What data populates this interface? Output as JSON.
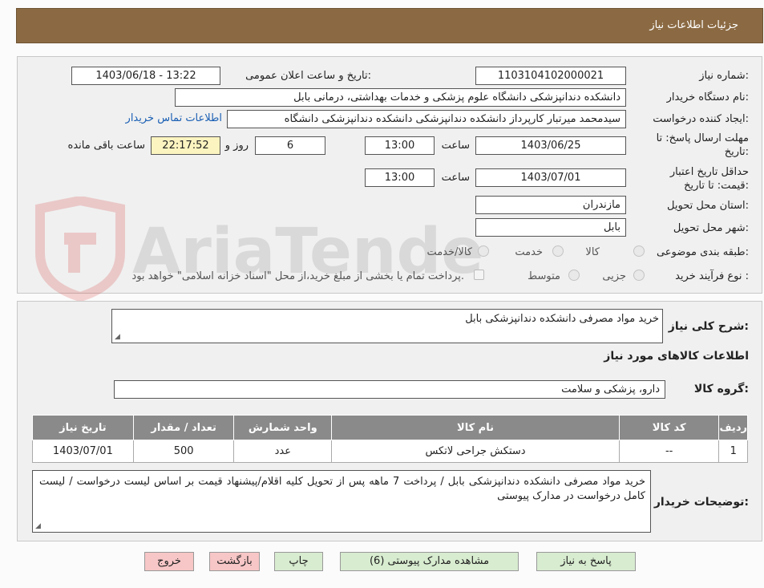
{
  "header": {
    "title": "جزئیات اطلاعات نیاز"
  },
  "watermark": {
    "text": "AriaTender.neT"
  },
  "info": {
    "need_number_label": "شماره نیاز:",
    "need_number": "1103104102000021",
    "announce_label": "تاریخ و ساعت اعلان عمومی:",
    "announce_value": "1403/06/18 - 13:22",
    "buyer_label": "نام دستگاه خریدار:",
    "buyer_value": "دانشکده دندانپزشکی دانشگاه علوم پزشکی و خدمات بهداشتی، درمانی بابل",
    "requester_label": "ایجاد کننده درخواست:",
    "requester_value": "سیدمحمد میرتبار کارپرداز دانشکده دندانپزشکی دانشکده دندانپزشکی دانشگاه",
    "contact_link": "اطلاعات تماس خریدار",
    "deadline_label_1": "مهلت ارسال پاسخ: تا",
    "deadline_label_2": "تاریخ:",
    "deadline_date": "1403/06/25",
    "time_label": "ساعت",
    "deadline_time": "13:00",
    "days_value": "6",
    "days_label": "روز و",
    "remaining_time": "22:17:52",
    "remaining_label": "ساعت باقی مانده",
    "validity_label_1": "حداقل تاریخ اعتبار",
    "validity_label_2": "قیمت: تا تاریخ:",
    "validity_date": "1403/07/01",
    "validity_time": "13:00",
    "province_label": "استان محل تحویل:",
    "province_value": "مازندران",
    "city_label": "شهر محل تحویل:",
    "city_value": "بابل",
    "category_label": "طبقه بندی موضوعی:",
    "cat_goods": "کالا",
    "cat_service": "خدمت",
    "cat_goods_service": "کالا/خدمت",
    "process_label": "نوع فرآیند خرید :",
    "proc_minor": "جزیی",
    "proc_medium": "متوسط",
    "payment_note": "پرداخت تمام یا بخشی از مبلغ خرید،از محل \"اسناد خزانه اسلامی\" خواهد بود."
  },
  "details": {
    "summary_label": "شرح کلی نیاز:",
    "summary_value": "خرید مواد مصرفی دانشکده دندانپزشکی بابل",
    "goods_info_title": "اطلاعات کالاهای مورد نیاز",
    "goods_group_label": "گروه کالا:",
    "goods_group_value": "دارو، پزشکی و سلامت",
    "table_headers": {
      "row": "ردیف",
      "code": "کد کالا",
      "name": "نام کالا",
      "unit": "واحد شمارش",
      "count": "تعداد / مقدار",
      "date": "تاریخ نیاز"
    },
    "rows": [
      {
        "row": "1",
        "code": "--",
        "name": "دستکش جراحی لاتکس",
        "unit": "عدد",
        "count": "500",
        "date": "1403/07/01"
      }
    ],
    "buyer_notes_label": "توضیحات خریدار:",
    "buyer_notes": "خرید مواد مصرفی دانشکده دندانپزشکی بابل / پرداخت 7 ماهه پس از تحویل کلیه اقلام/پیشنهاد قیمت بر اساس لیست درخواست / لیست  کامل درخواست  در مدارک پیوستی"
  },
  "buttons": {
    "reply": "پاسخ به نیاز",
    "attachments": "مشاهده مدارک پیوستی (6)",
    "print": "چاپ",
    "back": "بازگشت",
    "exit": "خروج"
  },
  "colors": {
    "header_bg": "#8b6a43",
    "table_header_bg": "#8a8a8a",
    "btn_green": "#d8ecd0",
    "btn_red": "#f7c6c6",
    "remaining_bg": "#fcf4c0"
  }
}
